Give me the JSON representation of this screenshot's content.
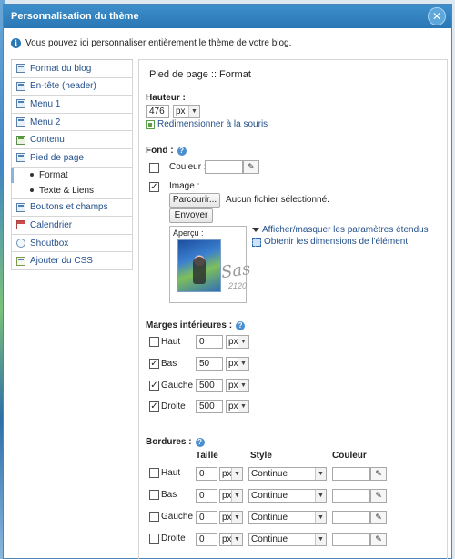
{
  "window": {
    "title": "Personnalisation du thème",
    "info": "Vous pouvez ici personnaliser entièrement le thème de votre blog."
  },
  "sidebar": {
    "items": [
      {
        "label": "Format du blog",
        "icon": "layout-icon"
      },
      {
        "label": "En-tête (header)",
        "icon": "header-icon"
      },
      {
        "label": "Menu 1",
        "icon": "menu-icon"
      },
      {
        "label": "Menu 2",
        "icon": "menu-icon"
      },
      {
        "label": "Contenu",
        "icon": "content-icon"
      },
      {
        "label": "Pied de page",
        "icon": "footer-icon"
      },
      {
        "label": "Boutons et champs",
        "icon": "buttons-icon"
      },
      {
        "label": "Calendrier",
        "icon": "calendar-icon"
      },
      {
        "label": "Shoutbox",
        "icon": "shoutbox-icon"
      },
      {
        "label": "Ajouter du CSS",
        "icon": "css-icon"
      }
    ],
    "footer_sub": [
      "Format",
      "Texte & Liens"
    ]
  },
  "main": {
    "title": "Pied de page :: Format",
    "hauteur": {
      "label": "Hauteur :",
      "value": "476",
      "unit": "px",
      "resize_link": "Redimensionner à la souris"
    },
    "fond": {
      "label": "Fond :",
      "couleur_label": "Couleur :",
      "couleur_value": "",
      "image_label": "Image :",
      "browse_label": "Parcourir...",
      "file_status": "Aucun fichier sélectionné.",
      "send_label": "Envoyer",
      "apercu_label": "Aperçu :",
      "toggle_link": "Afficher/masquer les paramètres étendus",
      "dimensions_link": "Obtenir les dimensions de l'élément",
      "signature": "Sas",
      "signature_year": "2120"
    },
    "marges": {
      "label": "Marges intérieures :",
      "rows": [
        {
          "label": "Haut",
          "checked": false,
          "value": "0",
          "unit": "px"
        },
        {
          "label": "Bas",
          "checked": true,
          "value": "50",
          "unit": "px"
        },
        {
          "label": "Gauche",
          "checked": true,
          "value": "500",
          "unit": "px"
        },
        {
          "label": "Droite",
          "checked": true,
          "value": "500",
          "unit": "px"
        }
      ]
    },
    "bordures": {
      "label": "Bordures :",
      "col_taille": "Taille",
      "col_style": "Style",
      "col_couleur": "Couleur",
      "rows": [
        {
          "label": "Haut",
          "value": "0",
          "unit": "px",
          "style": "Continue"
        },
        {
          "label": "Bas",
          "value": "0",
          "unit": "px",
          "style": "Continue"
        },
        {
          "label": "Gauche",
          "value": "0",
          "unit": "px",
          "style": "Continue"
        },
        {
          "label": "Droite",
          "value": "0",
          "unit": "px",
          "style": "Continue"
        }
      ]
    }
  },
  "colors": {
    "titlebar": "#2a77b4",
    "link": "#23508a"
  }
}
